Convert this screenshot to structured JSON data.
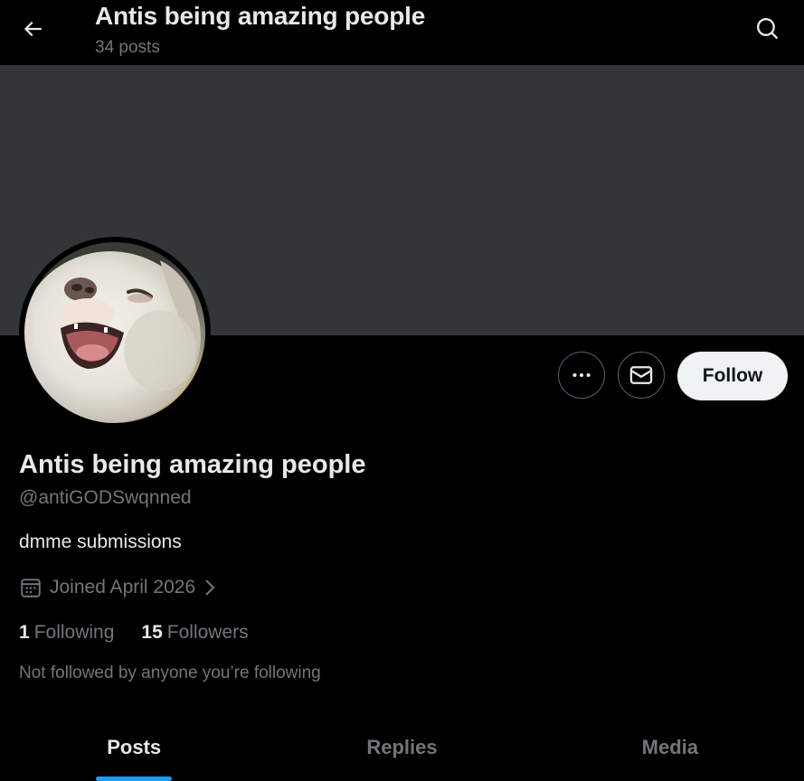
{
  "header": {
    "title": "Antis being amazing people",
    "post_count": "34 posts",
    "back_icon": "arrow-left-icon",
    "search_icon": "search-icon"
  },
  "banner": {
    "color": "#333639"
  },
  "profile": {
    "display_name": "Antis being amazing people",
    "handle": "@antiGODSwqnned",
    "bio": "dmme submissions",
    "joined": "Joined April 2026",
    "following_count": "1",
    "following_label": "Following",
    "followers_count": "15",
    "followers_label": "Followers",
    "not_followed_text": "Not followed by anyone you’re following"
  },
  "actions": {
    "more_icon": "more-dots-icon",
    "message_icon": "envelope-icon",
    "follow_label": "Follow"
  },
  "tabs": [
    {
      "label": "Posts",
      "active": true
    },
    {
      "label": "Replies",
      "active": false
    },
    {
      "label": "Media",
      "active": false
    }
  ],
  "colors": {
    "background": "#000000",
    "text_primary": "#e7e9ea",
    "text_secondary": "#71767b",
    "accent": "#1d9bf0",
    "follow_button_bg": "#eff3f4"
  }
}
